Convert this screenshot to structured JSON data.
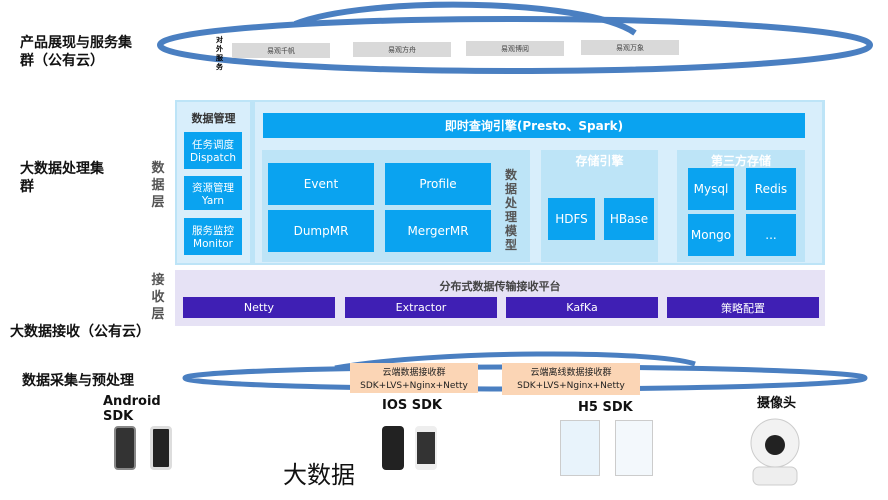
{
  "left_labels": {
    "product": "产品展现与服务集群（公有云）",
    "bigdata": "大数据处理集群",
    "receive": "大数据接收（公有云）",
    "collect": "数据采集与预处理"
  },
  "cloud_top": {
    "side_label": "对外服务",
    "items": [
      "易观千帆",
      "易观方舟",
      "易观博阅",
      "易观万象"
    ]
  },
  "data_layer": {
    "vlabel": "数据层",
    "mgmt_title": "数据管理",
    "mgmt_items": [
      "任务调度 Dispatch",
      "资源管理 Yarn",
      "服务监控 Monitor"
    ],
    "query_engine": "即时查询引擎(Presto、Spark)",
    "processing": {
      "items": [
        "Event",
        "Profile",
        "DumpMR",
        "MergerMR"
      ],
      "vlabel": "数据处理模型"
    },
    "storage": {
      "title": "存储引擎",
      "items": [
        "HDFS",
        "HBase"
      ]
    },
    "third_party": {
      "title": "第三方存储",
      "items": [
        "Mysql",
        "Redis",
        "Mongo",
        "..."
      ]
    }
  },
  "receive_layer": {
    "vlabel": "接收层",
    "title": "分布式数据传输接收平台",
    "items": [
      "Netty",
      "Extractor",
      "KafKa",
      "策略配置"
    ]
  },
  "cloud_bottom": {
    "groups": [
      {
        "title": "云端数据接收群",
        "stack": "SDK+LVS+Nginx+Netty"
      },
      {
        "title": "云端离线数据接收群",
        "stack": "SDK+LVS+Nginx+Netty"
      }
    ]
  },
  "devices": {
    "android": "Android SDK",
    "ios": "IOS SDK",
    "h5": "H5 SDK",
    "camera": "摄像头"
  },
  "overlay_text": "大数据",
  "colors": {
    "cloud_outline": "#4a7fc1",
    "panel": "#bde4f7",
    "box": "#0aa3f0",
    "receive_button": "#3f1fb4",
    "peach": "#fbd5b5"
  }
}
